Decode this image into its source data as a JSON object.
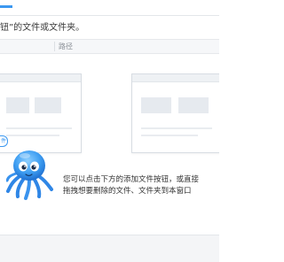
{
  "hint": {
    "text": "钮”的文件或文件夹。"
  },
  "table": {
    "columns": [
      "路径"
    ]
  },
  "illustration": {
    "small_label": "件"
  },
  "empty_state": {
    "line1": "您可以点击下方的添加文件按钮，或直接",
    "line2": "拖拽想要删除的文件、文件夹到本窗口"
  },
  "colors": {
    "accent": "#3c98f0",
    "header_bg": "#f6f7f9",
    "mockup_block": "#e6eaef"
  },
  "icons": {
    "mascot": "octopus-mascot-icon"
  }
}
